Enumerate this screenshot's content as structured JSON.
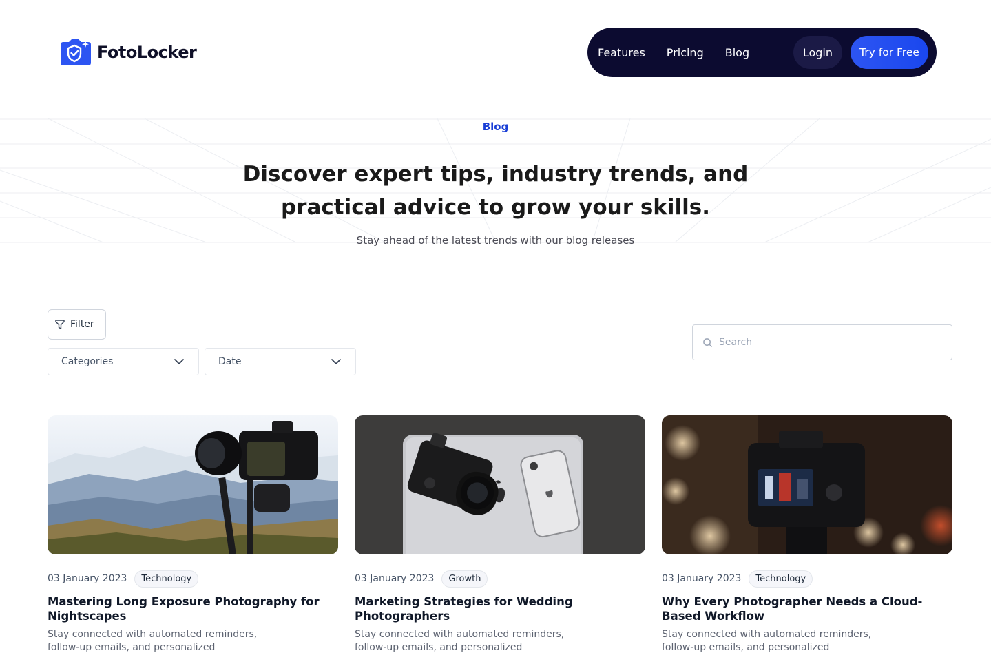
{
  "brand": {
    "name": "FotoLocker",
    "accent": "#1f4ff0",
    "nav_bg": "#0c0b30"
  },
  "nav": {
    "links": [
      "Features",
      "Pricing",
      "Blog"
    ],
    "login": "Login",
    "cta": "Try for Free"
  },
  "hero": {
    "tag": "Blog",
    "title": "Discover expert tips, industry trends, and practical advice to grow your skills.",
    "subtitle": "Stay ahead of the latest trends with our blog releases"
  },
  "filters": {
    "filter_label": "Filter",
    "categories_label": "Categories",
    "date_label": "Date",
    "search_placeholder": "Search"
  },
  "posts": [
    {
      "date": "03 January 2023",
      "category": "Technology",
      "title": "Mastering Long Exposure Photography for Nightscapes",
      "excerpt": "Stay connected with automated reminders, follow-up emails, and personalized",
      "image": "camera-on-tripod-mountains"
    },
    {
      "date": "03 January 2023",
      "category": "Growth",
      "title": "Marketing Strategies for Wedding Photographers",
      "excerpt": "Stay connected with automated reminders, follow-up emails, and personalized",
      "image": "camera-phone-on-laptop"
    },
    {
      "date": "03 January 2023",
      "category": "Technology",
      "title": "Why Every Photographer Needs a Cloud-Based Workflow",
      "excerpt": "Stay connected with automated reminders, follow-up emails, and personalized",
      "image": "canon-camera-night-bokeh"
    }
  ]
}
